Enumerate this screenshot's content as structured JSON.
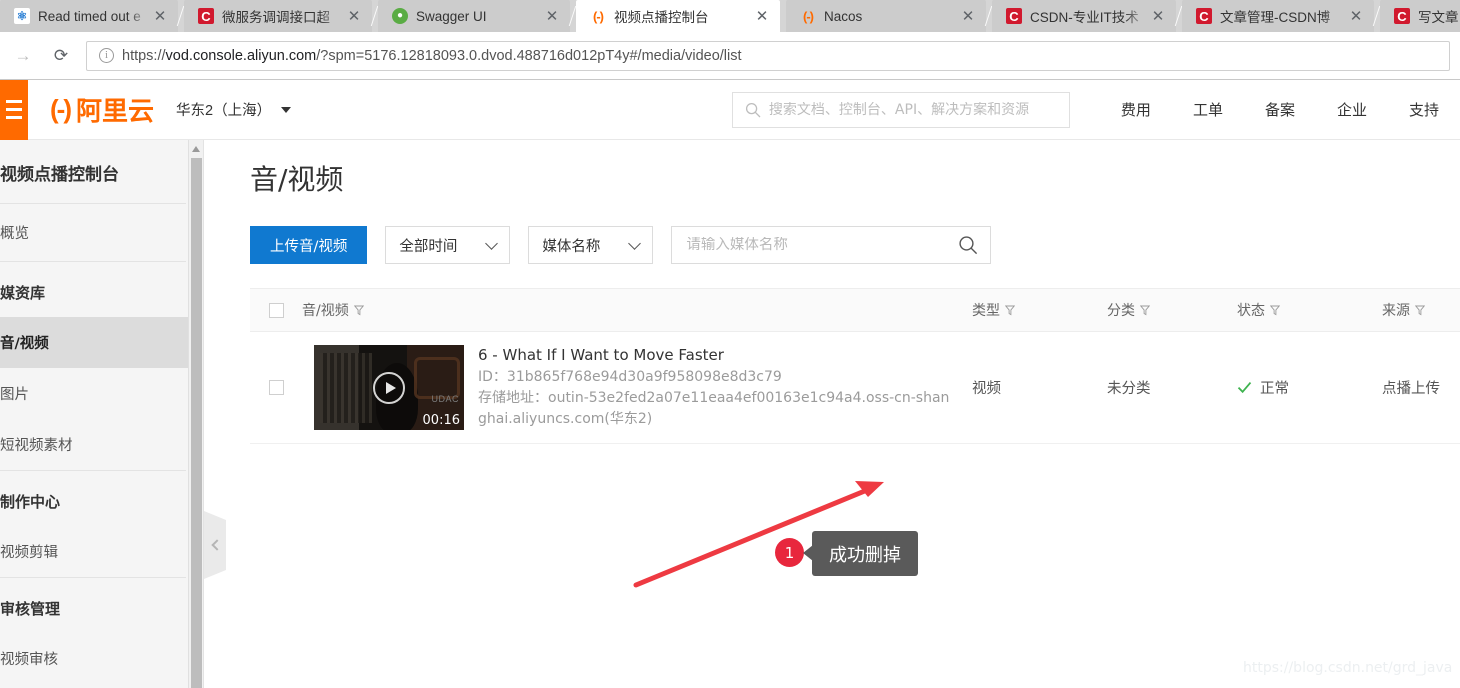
{
  "browser": {
    "tabs": [
      {
        "title": "Read timed out e",
        "favicon": "ide-icon",
        "active": false
      },
      {
        "title": "微服务调调接口超",
        "favicon": "csdn-icon",
        "active": false
      },
      {
        "title": "Swagger UI",
        "favicon": "swagger-icon",
        "active": false
      },
      {
        "title": "视频点播控制台",
        "favicon": "aliyun-icon",
        "active": true
      },
      {
        "title": "Nacos",
        "favicon": "aliyun-icon",
        "active": false
      },
      {
        "title": "CSDN-专业IT技术",
        "favicon": "csdn-icon",
        "active": false
      },
      {
        "title": "文章管理-CSDN博",
        "favicon": "csdn-icon",
        "active": false
      },
      {
        "title": "写文章",
        "favicon": "csdn-icon",
        "active": false
      }
    ],
    "close_label": "✕",
    "forward_icon": "→",
    "reload_icon": "⟳",
    "url_scheme": "https://",
    "url_host": "vod.console.aliyun.com",
    "url_path": "/?spm=5176.12818093.0.dvod.488716d012pT4y#/media/video/list"
  },
  "console_header": {
    "brand_mark": "(-)",
    "brand_name": "阿里云",
    "region": "华东2（上海）",
    "search_placeholder": "搜索文档、控制台、API、解决方案和资源",
    "search_value": "",
    "nav": [
      "费用",
      "工单",
      "备案",
      "企业",
      "支持"
    ]
  },
  "sidebar": {
    "title": "视频点播控制台",
    "overview": "概览",
    "groups": [
      {
        "label": "媒资库",
        "items": [
          {
            "label": "音/视频",
            "selected": true
          },
          {
            "label": "图片",
            "selected": false
          },
          {
            "label": "短视频素材",
            "selected": false
          }
        ]
      },
      {
        "label": "制作中心",
        "items": [
          {
            "label": "视频剪辑",
            "selected": false
          }
        ]
      },
      {
        "label": "审核管理",
        "items": [
          {
            "label": "视频审核",
            "selected": false
          }
        ]
      }
    ]
  },
  "main": {
    "page_title": "音/视频",
    "toolbar": {
      "upload_label": "上传音/视频",
      "time_filter": "全部时间",
      "field_filter": "媒体名称",
      "search_placeholder": "请输入媒体名称",
      "search_value": ""
    },
    "table": {
      "columns": [
        {
          "label": "音/视频",
          "filterable": true
        },
        {
          "label": "类型",
          "filterable": true
        },
        {
          "label": "分类",
          "filterable": true
        },
        {
          "label": "状态",
          "filterable": true
        },
        {
          "label": "来源",
          "filterable": true
        }
      ],
      "rows": [
        {
          "duration": "00:16",
          "thumb_overlay_text": "UDAC",
          "name": "6 - What If I Want to Move Faster",
          "id_label": "ID：",
          "id_value": "31b865f768e94d30a9f958098e8d3c79",
          "storage_label": "存储地址：",
          "storage_value": "outin-53e2fed2a07e11eaa4ef00163e1c94a4.oss-cn-shanghai.aliyuncs.com(华东2)",
          "type": "视频",
          "category": "未分类",
          "status": "正常",
          "source": "点播上传"
        }
      ]
    }
  },
  "annotation": {
    "badge": "1",
    "callout_text": "成功删掉",
    "arrow_color": "#ee3a42"
  },
  "watermark": "https://blog.csdn.net/grd_java",
  "colors": {
    "aliyun_orange": "#ff6a00",
    "primary_blue": "#1079d0",
    "status_green": "#3eb34f",
    "annotation_red": "#e8273d"
  }
}
